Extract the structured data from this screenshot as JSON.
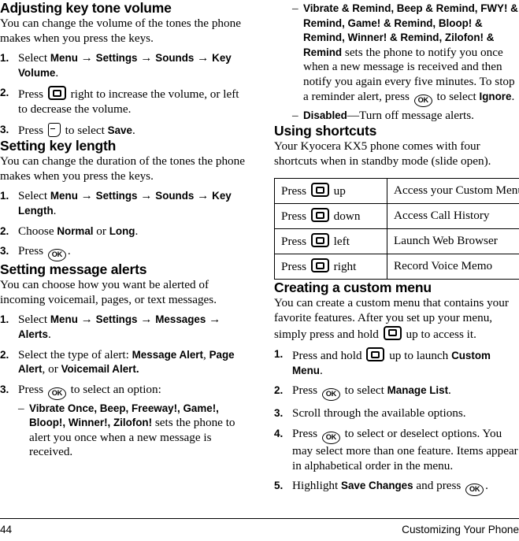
{
  "page": {
    "number": "44",
    "running_head": "Customizing Your Phone"
  },
  "icons": {
    "nav_key": "navigation-key-icon",
    "ok_key": "ok-key-icon",
    "soft_key": "soft-key-icon",
    "ok_label": "OK"
  },
  "left_column": {
    "sections": [
      {
        "heading": "Adjusting key tone volume",
        "intro": "You can change the volume of the tones the phone makes when you press the keys.",
        "steps": [
          {
            "num": "1.",
            "parts": [
              {
                "t": "text",
                "v": "Select "
              },
              {
                "t": "ui",
                "v": "Menu"
              },
              {
                "t": "arrow",
                "v": " → "
              },
              {
                "t": "ui",
                "v": "Settings"
              },
              {
                "t": "arrow",
                "v": " → "
              },
              {
                "t": "ui",
                "v": "Sounds"
              },
              {
                "t": "arrow",
                "v": " → "
              },
              {
                "t": "ui",
                "v": "Key Volume"
              },
              {
                "t": "text",
                "v": "."
              }
            ]
          },
          {
            "num": "2.",
            "parts": [
              {
                "t": "text",
                "v": "Press "
              },
              {
                "t": "icon",
                "v": "nav"
              },
              {
                "t": "text",
                "v": " right to increase the volume, or left to decrease the volume."
              }
            ]
          },
          {
            "num": "3.",
            "parts": [
              {
                "t": "text",
                "v": "Press "
              },
              {
                "t": "icon",
                "v": "soft"
              },
              {
                "t": "text",
                "v": " to select "
              },
              {
                "t": "ui",
                "v": "Save"
              },
              {
                "t": "text",
                "v": "."
              }
            ]
          }
        ]
      },
      {
        "heading": "Setting key length",
        "intro": "You can change the duration of the tones the phone makes when you press the keys.",
        "steps": [
          {
            "num": "1.",
            "parts": [
              {
                "t": "text",
                "v": "Select "
              },
              {
                "t": "ui",
                "v": "Menu"
              },
              {
                "t": "arrow",
                "v": " → "
              },
              {
                "t": "ui",
                "v": "Settings"
              },
              {
                "t": "arrow",
                "v": " → "
              },
              {
                "t": "ui",
                "v": "Sounds"
              },
              {
                "t": "arrow",
                "v": " → "
              },
              {
                "t": "ui",
                "v": "Key Length"
              },
              {
                "t": "text",
                "v": "."
              }
            ]
          },
          {
            "num": "2.",
            "parts": [
              {
                "t": "text",
                "v": "Choose "
              },
              {
                "t": "ui",
                "v": "Normal"
              },
              {
                "t": "text",
                "v": " or "
              },
              {
                "t": "ui",
                "v": "Long"
              },
              {
                "t": "text",
                "v": "."
              }
            ]
          },
          {
            "num": "3.",
            "parts": [
              {
                "t": "text",
                "v": "Press "
              },
              {
                "t": "icon",
                "v": "ok"
              },
              {
                "t": "text",
                "v": "."
              }
            ]
          }
        ]
      },
      {
        "heading": "Setting message alerts",
        "intro": "You can choose how you want be alerted of incoming voicemail, pages, or text messages.",
        "steps": [
          {
            "num": "1.",
            "parts": [
              {
                "t": "text",
                "v": "Select "
              },
              {
                "t": "ui",
                "v": "Menu"
              },
              {
                "t": "arrow",
                "v": " → "
              },
              {
                "t": "ui",
                "v": "Settings"
              },
              {
                "t": "arrow",
                "v": " → "
              },
              {
                "t": "ui",
                "v": "Messages"
              },
              {
                "t": "arrow",
                "v": " → "
              },
              {
                "t": "ui",
                "v": "Alerts"
              },
              {
                "t": "text",
                "v": "."
              }
            ]
          },
          {
            "num": "2.",
            "parts": [
              {
                "t": "text",
                "v": "Select the type of alert: "
              },
              {
                "t": "ui",
                "v": "Message Alert"
              },
              {
                "t": "text",
                "v": ", "
              },
              {
                "t": "ui",
                "v": "Page Alert"
              },
              {
                "t": "text",
                "v": ", or "
              },
              {
                "t": "ui",
                "v": "Voicemail Alert."
              }
            ]
          },
          {
            "num": "3.",
            "parts": [
              {
                "t": "text",
                "v": "Press "
              },
              {
                "t": "icon",
                "v": "ok"
              },
              {
                "t": "text",
                "v": " to select an option:"
              }
            ],
            "sublist": [
              {
                "parts": [
                  {
                    "t": "ui",
                    "v": "Vibrate Once, Beep, Freeway!, Game!, Bloop!, Winner!, Zilofon!"
                  },
                  {
                    "t": "text",
                    "v": " sets the phone to alert you once when a new message is received."
                  }
                ]
              }
            ]
          }
        ]
      }
    ]
  },
  "right_column": {
    "continued_sublist": [
      {
        "parts": [
          {
            "t": "ui",
            "v": "Vibrate & Remind, Beep & Remind, FWY! & Remind, Game! & Remind, Bloop! & Remind, Winner! & Remind, Zilofon! & Remind"
          },
          {
            "t": "text",
            "v": " sets the phone to notify you once when a new message is received and then notify you again every five minutes. To stop a reminder alert, press "
          },
          {
            "t": "icon",
            "v": "ok"
          },
          {
            "t": "text",
            "v": " to select "
          },
          {
            "t": "ui",
            "v": "Ignore"
          },
          {
            "t": "text",
            "v": "."
          }
        ]
      },
      {
        "parts": [
          {
            "t": "ui",
            "v": "Disabled"
          },
          {
            "t": "text",
            "v": "—Turn off message alerts."
          }
        ]
      }
    ],
    "sections": [
      {
        "heading": "Using shortcuts",
        "intro": "Your Kyocera KX5 phone comes with four shortcuts when in standby mode (slide open).",
        "table": {
          "rows": [
            {
              "press_prefix": "Press",
              "direction": "up",
              "action": "Access your Custom Menu"
            },
            {
              "press_prefix": "Press",
              "direction": "down",
              "action": "Access Call History"
            },
            {
              "press_prefix": "Press",
              "direction": "left",
              "action": "Launch Web Browser"
            },
            {
              "press_prefix": "Press",
              "direction": "right",
              "action": "Record Voice Memo"
            }
          ]
        }
      },
      {
        "heading": "Creating a custom menu",
        "intro_parts": [
          {
            "t": "text",
            "v": "You can create a custom menu that contains your favorite features. After you set up your menu, simply press and hold "
          },
          {
            "t": "icon",
            "v": "nav"
          },
          {
            "t": "text",
            "v": " up to access it."
          }
        ],
        "steps": [
          {
            "num": "1.",
            "parts": [
              {
                "t": "text",
                "v": "Press and hold "
              },
              {
                "t": "icon",
                "v": "nav"
              },
              {
                "t": "text",
                "v": " up to launch "
              },
              {
                "t": "ui",
                "v": "Custom Menu"
              },
              {
                "t": "text",
                "v": "."
              }
            ]
          },
          {
            "num": "2.",
            "parts": [
              {
                "t": "text",
                "v": "Press "
              },
              {
                "t": "icon",
                "v": "ok"
              },
              {
                "t": "text",
                "v": " to select "
              },
              {
                "t": "ui",
                "v": "Manage List"
              },
              {
                "t": "text",
                "v": "."
              }
            ]
          },
          {
            "num": "3.",
            "parts": [
              {
                "t": "text",
                "v": "Scroll through the available options."
              }
            ]
          },
          {
            "num": "4.",
            "parts": [
              {
                "t": "text",
                "v": "Press "
              },
              {
                "t": "icon",
                "v": "ok"
              },
              {
                "t": "text",
                "v": " to select or deselect options. You may select more than one feature. Items appear in alphabetical order in the menu."
              }
            ]
          },
          {
            "num": "5.",
            "parts": [
              {
                "t": "text",
                "v": "Highlight "
              },
              {
                "t": "ui",
                "v": "Save Changes"
              },
              {
                "t": "text",
                "v": " and press "
              },
              {
                "t": "icon",
                "v": "ok"
              },
              {
                "t": "text",
                "v": "."
              }
            ]
          }
        ]
      }
    ]
  }
}
